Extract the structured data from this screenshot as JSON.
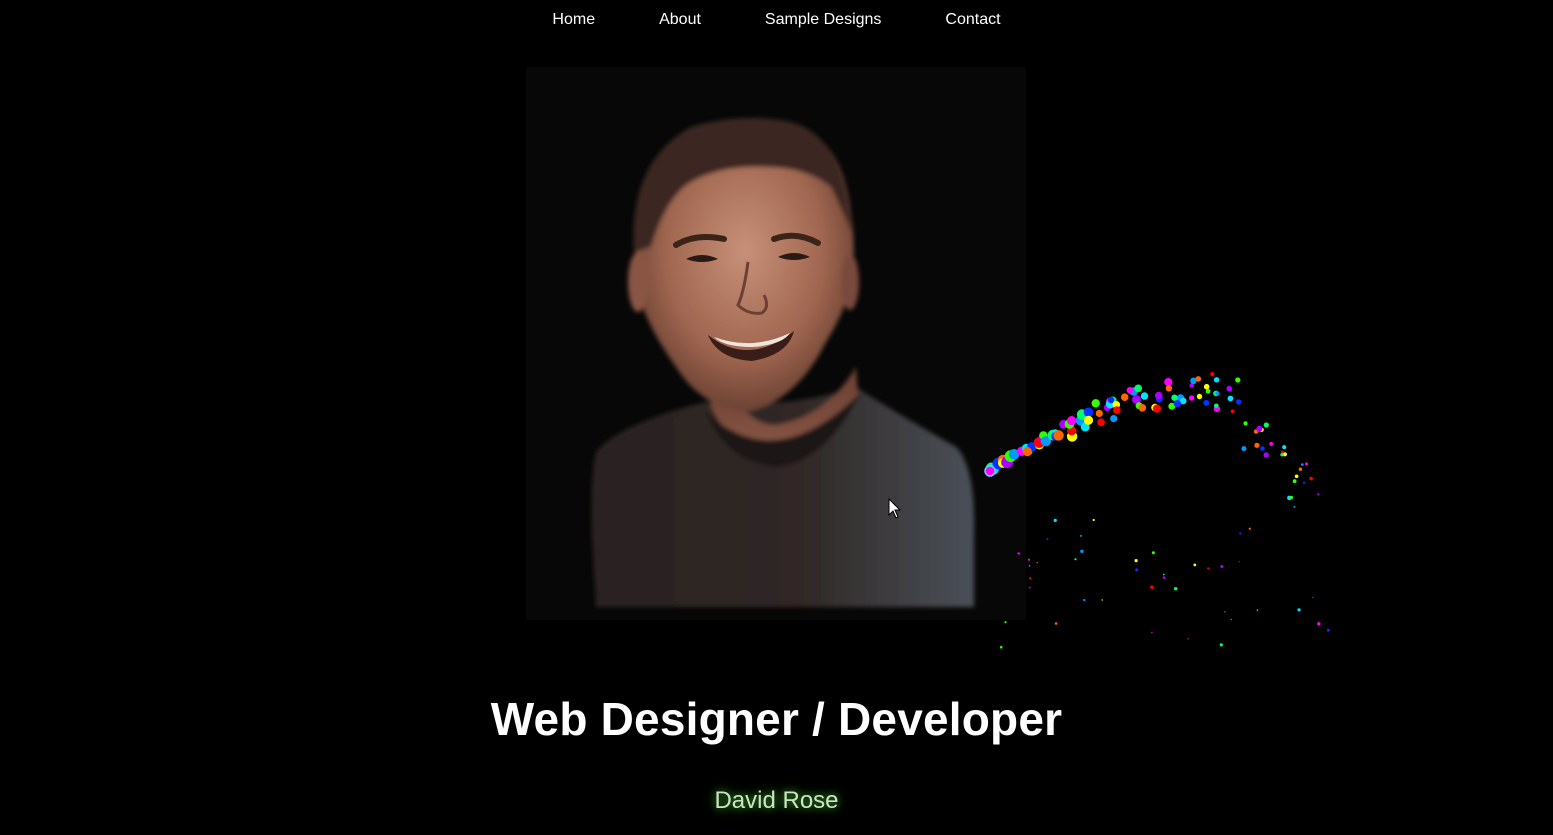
{
  "nav": {
    "items": [
      {
        "label": "Home",
        "name": "nav-home"
      },
      {
        "label": "About",
        "name": "nav-about"
      },
      {
        "label": "Sample Designs",
        "name": "nav-sample-designs"
      },
      {
        "label": "Contact",
        "name": "nav-contact"
      }
    ]
  },
  "hero": {
    "headline": "Web Designer / Developer",
    "name": "David Rose"
  },
  "colors": {
    "background": "#000000",
    "name_glow": "#3c8a2c",
    "particles": [
      "#ff00ff",
      "#00ff66",
      "#00e5ff",
      "#0033ff",
      "#ff6600",
      "#ffff00",
      "#ff0000",
      "#aa00ff",
      "#33ff00",
      "#0099ff"
    ]
  },
  "icons": {
    "cursor": "mouse-pointer-icon"
  }
}
